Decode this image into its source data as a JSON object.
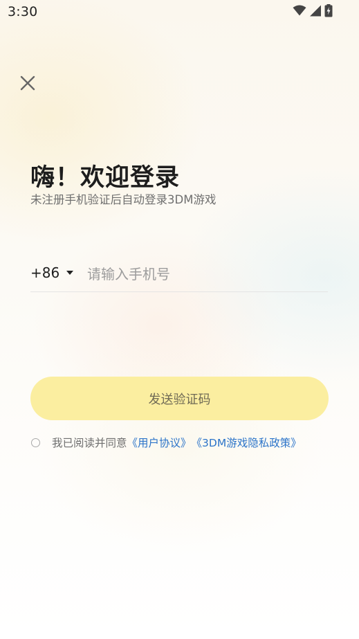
{
  "status_bar": {
    "time": "3:30",
    "icons": [
      "wifi-icon",
      "cellular-signal-icon",
      "battery-charging-icon"
    ]
  },
  "header": {
    "close_icon": "close-icon"
  },
  "main": {
    "title": "嗨！欢迎登录",
    "subtitle": "未注册手机验证后自动登录3DM游戏",
    "phone": {
      "country_code": "+86",
      "value": "",
      "placeholder": "请输入手机号"
    },
    "send_code_label": "发送验证码",
    "agreement": {
      "prefix": "我已阅读并同意",
      "user_agreement": "《用户协议》",
      "privacy_policy": "《3DM游戏隐私政策》",
      "checked": false
    }
  },
  "colors": {
    "button_bg": "#fbeea0",
    "link": "#2c74c9",
    "title_text": "#1d1d1d",
    "secondary_text": "#6f6f6f"
  }
}
